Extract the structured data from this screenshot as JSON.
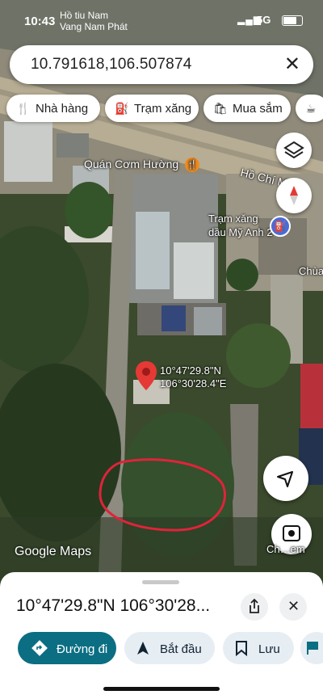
{
  "status_bar": {
    "time": "10:43",
    "notification_line1": "Hồ tiu Nam",
    "notification_line2": "Vang Nam Phát",
    "network": "5G"
  },
  "search": {
    "query": "10.791618,106.507874",
    "clear_icon": "close-icon"
  },
  "chips": [
    {
      "icon": "restaurant-icon",
      "label": "Nhà hàng"
    },
    {
      "icon": "gas-station-icon",
      "label": "Trạm xăng"
    },
    {
      "icon": "shopping-bag-icon",
      "label": "Mua sắm"
    },
    {
      "icon": "coffee-icon",
      "label": ""
    }
  ],
  "map": {
    "labels": {
      "restaurant": "Quán Cơm Hường",
      "road": "Hồ Chí Minh",
      "gas_station_line1": "Trạm xăng",
      "gas_station_line2": "dầu Mỹ Anh 2",
      "chua": "Chùa"
    },
    "pin": {
      "lat_text": "10°47'29.8\"N",
      "lng_text": "106°30'28.4\"E"
    },
    "watermark": "Google Maps",
    "streetview_label": "Ch…em",
    "colors": {
      "pin": "#e53935",
      "annotation_circle": "#e0233a"
    }
  },
  "sheet": {
    "coordinates_title": "10°47'29.8\"N 106°30'28...",
    "actions": [
      {
        "icon": "directions-icon",
        "label": "Đường đi"
      },
      {
        "icon": "navigation-arrow-icon",
        "label": "Bắt đầu"
      },
      {
        "icon": "bookmark-icon",
        "label": "Lưu"
      }
    ],
    "colors": {
      "primary": "#0b6e82",
      "secondary": "#e6edf3"
    }
  }
}
